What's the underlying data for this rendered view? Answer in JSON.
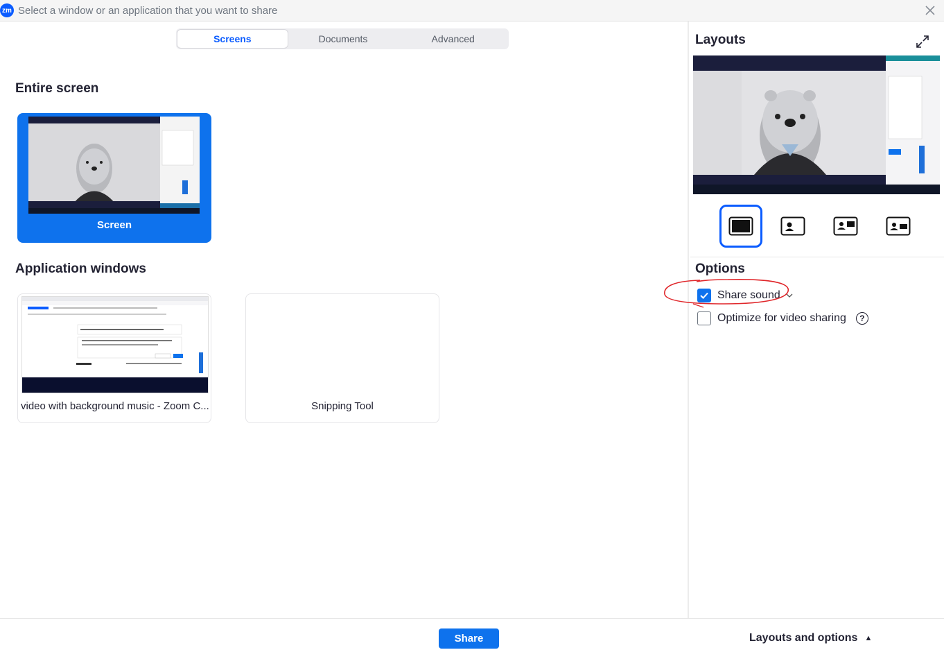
{
  "window": {
    "logo_text": "zm",
    "title": "Select a window or an application that you want to share"
  },
  "tabs": [
    {
      "label": "Screens",
      "active": true
    },
    {
      "label": "Documents",
      "active": false
    },
    {
      "label": "Advanced",
      "active": false
    }
  ],
  "entire_screen": {
    "heading": "Entire screen",
    "card_label": "Screen",
    "selected": true
  },
  "application_windows": {
    "heading": "Application windows",
    "items": [
      {
        "label": "video with background music - Zoom C..."
      },
      {
        "label": "Snipping Tool"
      }
    ]
  },
  "layouts": {
    "heading": "Layouts",
    "selected_index": 0,
    "options": [
      "content-only-icon",
      "content-person-icon",
      "content-person-right-icon",
      "content-person-center-icon"
    ]
  },
  "options": {
    "heading": "Options",
    "share_sound": {
      "label": "Share sound",
      "checked": true
    },
    "optimize_video": {
      "label": "Optimize for video sharing",
      "checked": false
    }
  },
  "footer": {
    "share_label": "Share",
    "layouts_options_label": "Layouts and options"
  },
  "colors": {
    "accent": "#0e72ed",
    "annotation": "#e0272b"
  }
}
